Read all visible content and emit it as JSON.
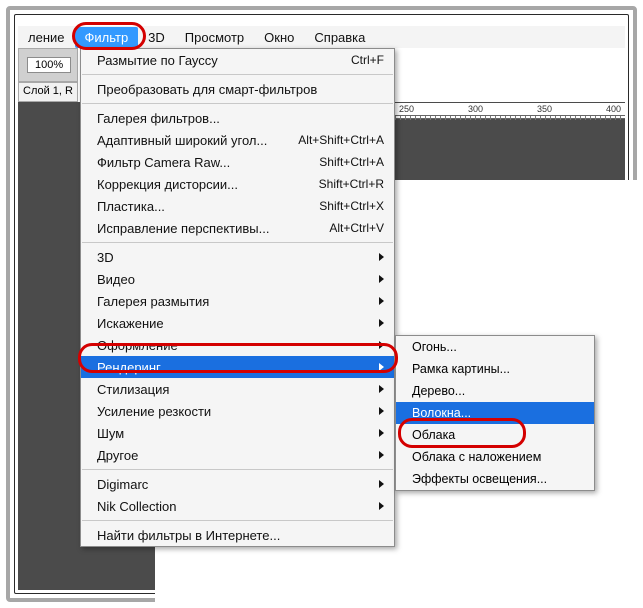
{
  "menubar": {
    "items": [
      {
        "label": "ление"
      },
      {
        "label": "Фильтр",
        "selected": true
      },
      {
        "label": "3D"
      },
      {
        "label": "Просмотр"
      },
      {
        "label": "Окно"
      },
      {
        "label": "Справка"
      }
    ]
  },
  "toolbar": {
    "zoom": "100%"
  },
  "tab": {
    "label": "Слой 1, R"
  },
  "ruler": {
    "ticks": [
      "250",
      "300",
      "350",
      "400"
    ]
  },
  "menu1": [
    {
      "type": "item",
      "label": "Размытие по Гауссу",
      "shortcut": "Ctrl+F"
    },
    {
      "type": "sep"
    },
    {
      "type": "item",
      "label": "Преобразовать для смарт-фильтров"
    },
    {
      "type": "sep"
    },
    {
      "type": "item",
      "label": "Галерея фильтров..."
    },
    {
      "type": "item",
      "label": "Адаптивный широкий угол...",
      "shortcut": "Alt+Shift+Ctrl+A"
    },
    {
      "type": "item",
      "label": "Фильтр Camera Raw...",
      "shortcut": "Shift+Ctrl+A"
    },
    {
      "type": "item",
      "label": "Коррекция дисторсии...",
      "shortcut": "Shift+Ctrl+R"
    },
    {
      "type": "item",
      "label": "Пластика...",
      "shortcut": "Shift+Ctrl+X"
    },
    {
      "type": "item",
      "label": "Исправление перспективы...",
      "shortcut": "Alt+Ctrl+V"
    },
    {
      "type": "sep"
    },
    {
      "type": "item",
      "label": "3D",
      "submenu": true
    },
    {
      "type": "item",
      "label": "Видео",
      "submenu": true
    },
    {
      "type": "item",
      "label": "Галерея размытия",
      "submenu": true
    },
    {
      "type": "item",
      "label": "Искажение",
      "submenu": true
    },
    {
      "type": "item",
      "label": "Оформление",
      "submenu": true
    },
    {
      "type": "item",
      "label": "Рендеринг",
      "submenu": true,
      "selected": true
    },
    {
      "type": "item",
      "label": "Стилизация",
      "submenu": true
    },
    {
      "type": "item",
      "label": "Усиление резкости",
      "submenu": true
    },
    {
      "type": "item",
      "label": "Шум",
      "submenu": true
    },
    {
      "type": "item",
      "label": "Другое",
      "submenu": true
    },
    {
      "type": "sep"
    },
    {
      "type": "item",
      "label": "Digimarc",
      "submenu": true
    },
    {
      "type": "item",
      "label": "Nik Collection",
      "submenu": true
    },
    {
      "type": "sep"
    },
    {
      "type": "item",
      "label": "Найти фильтры в Интернете..."
    }
  ],
  "menu2": [
    {
      "label": "Огонь..."
    },
    {
      "label": "Рамка картины..."
    },
    {
      "label": "Дерево..."
    },
    {
      "type": "sep"
    },
    {
      "label": "Волокна...",
      "selected": true
    },
    {
      "label": "Облака"
    },
    {
      "label": "Облака с наложением"
    },
    {
      "label": "Эффекты освещения..."
    }
  ]
}
